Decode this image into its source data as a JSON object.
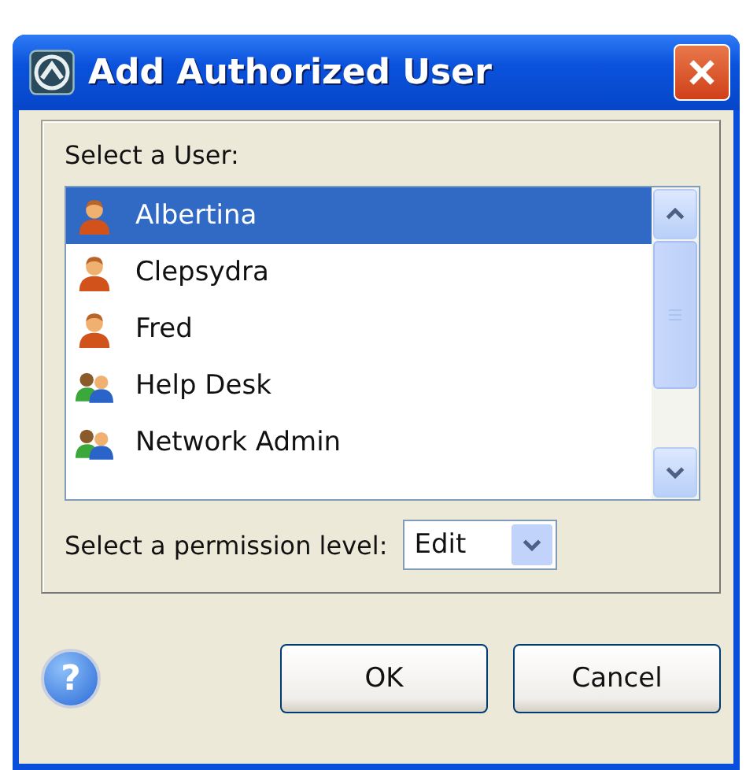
{
  "window": {
    "title": "Add Authorized User"
  },
  "user_list": {
    "label": "Select a User:",
    "items": [
      {
        "name": "Albertina",
        "kind": "user",
        "selected": true
      },
      {
        "name": "Clepsydra",
        "kind": "user",
        "selected": false
      },
      {
        "name": "Fred",
        "kind": "user",
        "selected": false
      },
      {
        "name": "Help Desk",
        "kind": "group",
        "selected": false
      },
      {
        "name": "Network Admin",
        "kind": "group",
        "selected": false
      }
    ]
  },
  "permission": {
    "label": "Select a permission level:",
    "value": "Edit"
  },
  "help": "?",
  "buttons": [
    "OK",
    "Cancel"
  ]
}
